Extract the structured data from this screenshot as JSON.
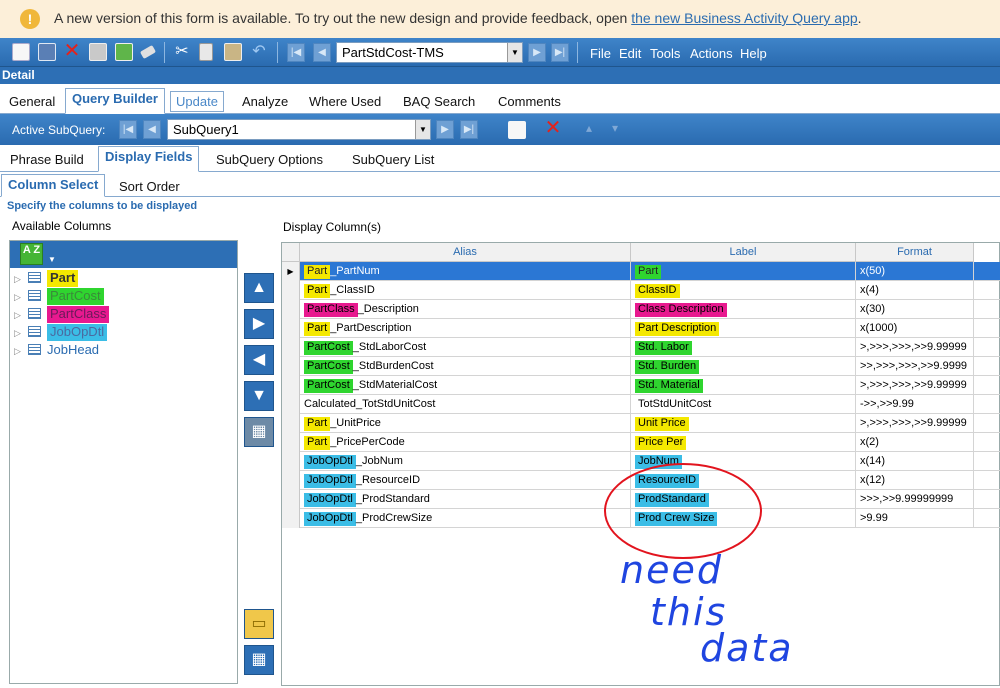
{
  "notice": {
    "message": "A new version of this form is available. To try out the new design and provide feedback, open ",
    "link": "the new Business Activity Query app",
    "end": "."
  },
  "toolbar": {
    "record_combo": "PartStdCost-TMS",
    "menus": [
      "File",
      "Edit",
      "Tools",
      "Actions",
      "Help"
    ]
  },
  "detail_label": "Detail",
  "main_tabs": [
    "General",
    "Query Builder",
    "Update",
    "Analyze",
    "Where Used",
    "BAQ Search",
    "Comments"
  ],
  "subquery": {
    "label": "Active SubQuery:",
    "value": "SubQuery1"
  },
  "sub_tabs": [
    "Phrase Build",
    "Display Fields",
    "SubQuery Options",
    "SubQuery List"
  ],
  "inner_tabs": [
    "Column Select",
    "Sort Order"
  ],
  "instruction": "Specify the columns to be displayed",
  "available_columns_label": "Available Columns",
  "display_columns_label": "Display Column(s)",
  "sort_icon_text": "A Z",
  "tree": [
    "Part",
    "PartCost",
    "PartClass",
    "JobOpDtl",
    "JobHead"
  ],
  "grid": {
    "headers": [
      "Alias",
      "Label",
      "Format"
    ],
    "rows": [
      {
        "prefix": "Part",
        "suffix": "_PartNum",
        "label": "Part",
        "format": "x(50)",
        "color": "y",
        "lcolor": "g"
      },
      {
        "prefix": "Part",
        "suffix": "_ClassID",
        "label": "ClassID",
        "format": "x(4)",
        "color": "y",
        "lcolor": "y"
      },
      {
        "prefix": "PartClass",
        "suffix": "_Description",
        "label": "Class Description",
        "format": "x(30)",
        "color": "m",
        "lcolor": "m"
      },
      {
        "prefix": "Part",
        "suffix": "_PartDescription",
        "label": "Part Description",
        "format": "x(1000)",
        "color": "y",
        "lcolor": "y"
      },
      {
        "prefix": "PartCost",
        "suffix": "_StdLaborCost",
        "label": "Std. Labor",
        "format": ">,>>>,>>>,>>9.99999",
        "color": "g",
        "lcolor": "g"
      },
      {
        "prefix": "PartCost",
        "suffix": "_StdBurdenCost",
        "label": "Std. Burden",
        "format": ">>,>>>,>>>,>>9.9999",
        "color": "g",
        "lcolor": "g"
      },
      {
        "prefix": "PartCost",
        "suffix": "_StdMaterialCost",
        "label": "Std. Material",
        "format": ">,>>>,>>>,>>9.99999",
        "color": "g",
        "lcolor": "g"
      },
      {
        "prefix": "",
        "suffix": "Calculated_TotStdUnitCost",
        "label": "TotStdUnitCost",
        "format": "->>,>>9.99",
        "color": "",
        "lcolor": ""
      },
      {
        "prefix": "Part",
        "suffix": "_UnitPrice",
        "label": "Unit Price",
        "format": ">,>>>,>>>,>>9.99999",
        "color": "y",
        "lcolor": "y"
      },
      {
        "prefix": "Part",
        "suffix": "_PricePerCode",
        "label": "Price Per",
        "format": "x(2)",
        "color": "y",
        "lcolor": "y"
      },
      {
        "prefix": "JobOpDtl",
        "suffix": "_JobNum",
        "label": "JobNum",
        "format": "x(14)",
        "color": "c",
        "lcolor": "c"
      },
      {
        "prefix": "JobOpDtl",
        "suffix": "_ResourceID",
        "label": "ResourceID",
        "format": "x(12)",
        "color": "c",
        "lcolor": "c"
      },
      {
        "prefix": "JobOpDtl",
        "suffix": "_ProdStandard",
        "label": "ProdStandard",
        "format": ">>>,>>9.99999999",
        "color": "c",
        "lcolor": "c"
      },
      {
        "prefix": "JobOpDtl",
        "suffix": "_ProdCrewSize",
        "label": "Prod Crew Size",
        "format": ">9.99",
        "color": "c",
        "lcolor": "c"
      }
    ]
  },
  "annotation": {
    "line1": "need",
    "line2": "this",
    "line3": "data"
  },
  "colors": {
    "toolbar_blue": "#2d6fb5",
    "highlight_yellow": "#f4e800",
    "highlight_green": "#2fd52f",
    "highlight_magenta": "#e8198f",
    "highlight_cyan": "#3bbde6",
    "annotation_red": "#e2141e",
    "annotation_blue": "#1f45e0"
  }
}
